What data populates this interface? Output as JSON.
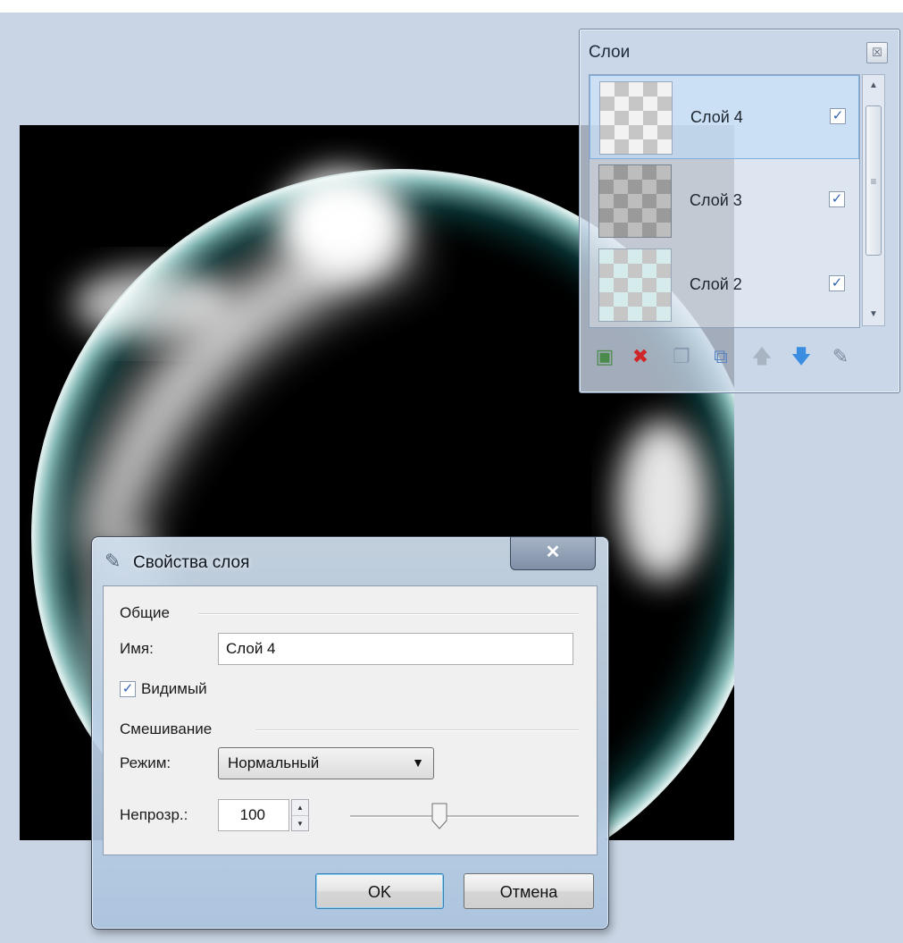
{
  "layers_panel": {
    "title": "Слои",
    "close_glyph": "☒",
    "layers": [
      {
        "name": "Слой 4",
        "visible_glyph": "✓",
        "selected": true
      },
      {
        "name": "Слой 3",
        "visible_glyph": "✓",
        "selected": false
      },
      {
        "name": "Слой 2",
        "visible_glyph": "✓",
        "selected": false
      }
    ],
    "scroll_up_glyph": "▲",
    "scroll_down_glyph": "▼",
    "scroll_grip_glyph": "≡",
    "toolbar": {
      "add_glyph": "▣",
      "delete_glyph": "✖",
      "duplicate_glyph": "❐",
      "merge_glyph": "⧉",
      "move_up_glyph": "🡅",
      "move_down_glyph": "🡇",
      "properties_glyph": "✎"
    }
  },
  "dialog": {
    "title": "Свойства слоя",
    "icon_glyph": "✎",
    "close_glyph": "✕",
    "general_group": "Общие",
    "name_label": "Имя:",
    "name_value": "Слой 4",
    "visible_glyph": "✓",
    "visible_label": "Видимый",
    "blending_group": "Смешивание",
    "mode_label": "Режим:",
    "mode_value": "Нормальный",
    "mode_arrow": "▼",
    "opacity_label": "Непрозр.:",
    "opacity_value": "100",
    "opacity_spin_up": "▲",
    "opacity_spin_down": "▼",
    "opacity_slider_fraction": 0.39,
    "ok_label": "OK",
    "cancel_label": "Отмена"
  },
  "colors": {
    "accent_blue": "#2f64b3",
    "delete_red": "#d0262a",
    "move_blue": "#3a8de0"
  }
}
